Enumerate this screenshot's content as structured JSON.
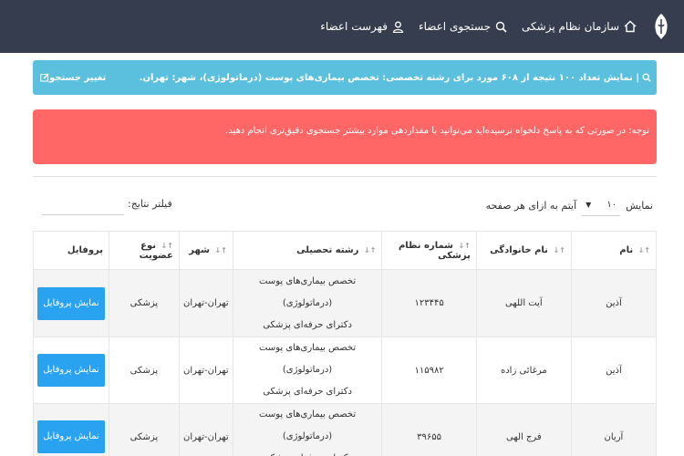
{
  "nav": {
    "items": [
      {
        "label": "سازمان نظام پزشکی",
        "icon": "home-icon"
      },
      {
        "label": "جستجوی اعضاء",
        "icon": "search-icon"
      },
      {
        "label": "فهرست اعضاء",
        "icon": "user-icon"
      }
    ]
  },
  "info_bar": {
    "text": "| نمایش تعداد ۱۰۰ نتیجه از ۶۰۸ مورد برای رشته تخصصی: تخصص بیماری‌های پوست (درماتولوژی)، شهر: تهران.",
    "change_search": "تغییر جستجو"
  },
  "alert": {
    "text": "توجه: در صورتی که به پاسخ دلخواه نرسیده‌اید می‌توانید با مقداردهی موارد بیشتر جستجوی دقیق‌تری انجام دهید."
  },
  "controls": {
    "show_label": "نمایش",
    "page_length": "۱۰",
    "items_label": "آیتم به ازای هر صفحه",
    "filter_label": "فیلتر نتایج:"
  },
  "table": {
    "headers": [
      "نام",
      "نام خانوادگی",
      "شماره نظام پزشکی",
      "رشته تحصیلی",
      "شهر",
      "نوع عضویت",
      "پروفایل"
    ],
    "button_label": "نمایش پروفایل",
    "rows": [
      {
        "first": "آذین",
        "last": "آیت اللهی",
        "number": "۱۲۳۴۴۵",
        "field1": "تخصص بیماری‌های پوست (درماتولوژی)",
        "field2": "دکترای حرفه‌ای پزشکی",
        "city": "تهران-تهران",
        "membership": "پزشکی"
      },
      {
        "first": "آذین",
        "last": "مرغائی زاده",
        "number": "۱۱۵۹۸۲",
        "field1": "تخصص بیماری‌های پوست (درماتولوژی)",
        "field2": "دکترای حرفه‌ای پزشکی",
        "city": "تهران-تهران",
        "membership": "پزشکی"
      },
      {
        "first": "آریان",
        "last": "فرج الهی",
        "number": "۳۹۶۵۵",
        "field1": "تخصص بیماری‌های پوست (درماتولوژی)",
        "field2": "دکترای حرفه‌ای پزشکی",
        "city": "تهران-تهران",
        "membership": "پزشکی"
      }
    ]
  },
  "colors": {
    "navbar": "#363d4e",
    "info": "#5bc0de",
    "alert": "#ff6666",
    "button": "#29a3f0"
  }
}
